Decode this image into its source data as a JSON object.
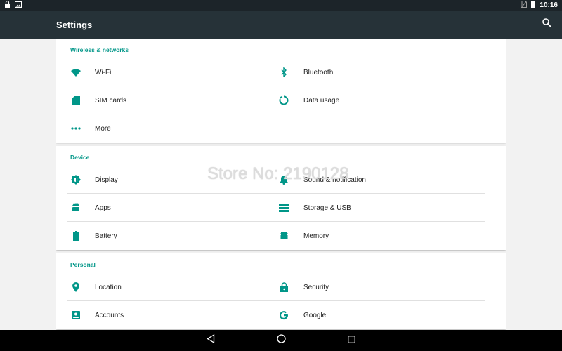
{
  "status_bar": {
    "time": "10:16",
    "icons": [
      "lock-icon",
      "image-icon",
      "no-sim-icon",
      "battery-icon"
    ]
  },
  "app_bar": {
    "title": "Settings",
    "search_icon": "search-icon"
  },
  "colors": {
    "accent": "#009688",
    "app_bar": "#263238",
    "status_bar": "#1c2429",
    "background": "#f2f2f2"
  },
  "sections": [
    {
      "title": "Wireless & networks",
      "items": [
        {
          "label": "Wi-Fi",
          "icon": "wifi-icon"
        },
        {
          "label": "Bluetooth",
          "icon": "bluetooth-icon"
        },
        {
          "label": "SIM cards",
          "icon": "sim-card-icon"
        },
        {
          "label": "Data usage",
          "icon": "data-usage-icon"
        },
        {
          "label": "More",
          "icon": "more-icon"
        }
      ]
    },
    {
      "title": "Device",
      "items": [
        {
          "label": "Display",
          "icon": "display-icon"
        },
        {
          "label": "Sound & notification",
          "icon": "bell-icon"
        },
        {
          "label": "Apps",
          "icon": "android-icon"
        },
        {
          "label": "Storage & USB",
          "icon": "storage-icon"
        },
        {
          "label": "Battery",
          "icon": "battery-icon"
        },
        {
          "label": "Memory",
          "icon": "memory-icon"
        }
      ]
    },
    {
      "title": "Personal",
      "items": [
        {
          "label": "Location",
          "icon": "location-icon"
        },
        {
          "label": "Security",
          "icon": "lock-icon"
        },
        {
          "label": "Accounts",
          "icon": "account-icon"
        },
        {
          "label": "Google",
          "icon": "google-icon"
        }
      ]
    }
  ],
  "watermark": "Store No: 2190128",
  "nav_bar": {
    "buttons": [
      "back-icon",
      "home-icon",
      "recents-icon"
    ]
  }
}
